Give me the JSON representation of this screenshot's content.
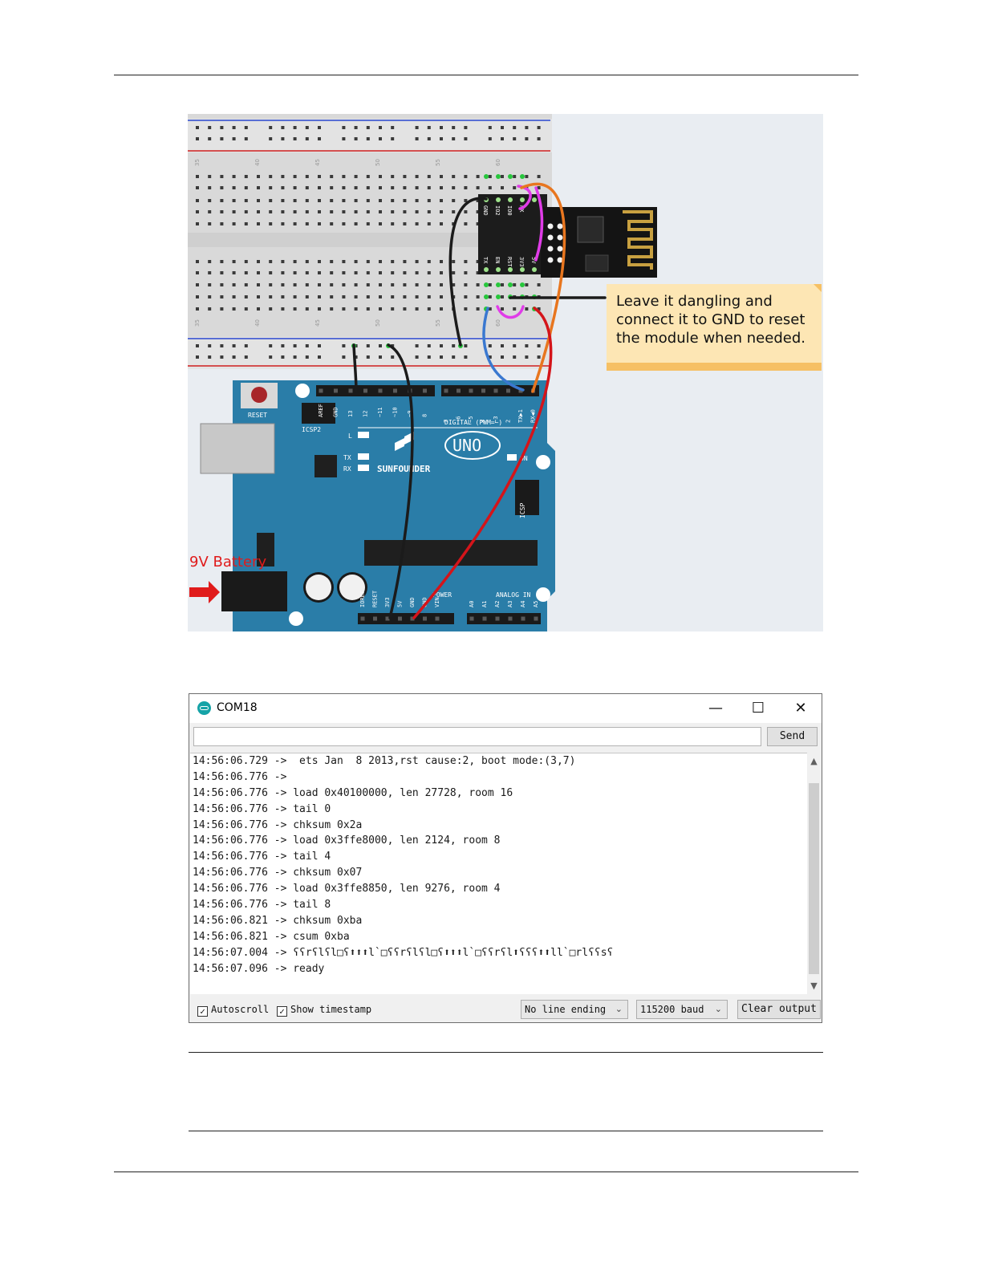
{
  "figure": {
    "note_lines": [
      "Leave it dangling and",
      "connect it to GND to reset",
      "the module when needed."
    ],
    "battery_label": "9V Battery",
    "breadboard_column_numbers": [
      "35",
      "40",
      "45",
      "50",
      "55",
      "60"
    ],
    "esp_pins_top": [
      "GND",
      "IO2",
      "IO0",
      "RX"
    ],
    "esp_pins_bottom": [
      "TX",
      "EN",
      "RST",
      "3V3"
    ],
    "esp_pin_5v": "5V",
    "board": {
      "brand": "SUNFOUNDER",
      "model": "UNO",
      "reset_label": "RESET",
      "icsp2_label": "ICSP2",
      "icsp_label": "ICSP",
      "digital_label": "DIGITAL (PWM=~)",
      "power_label": "POWER",
      "analog_label": "ANALOG IN",
      "led_labels": [
        "L",
        "TX",
        "RX"
      ],
      "on_label": "ON",
      "header_top_left": [
        "AREF",
        "GND",
        "13",
        "12",
        "~11",
        "~10",
        "~9",
        "8"
      ],
      "header_top_right": [
        "7",
        "~6",
        "~5",
        "4",
        "~3",
        "2",
        "TX▶1",
        "RX◀0"
      ],
      "header_power": [
        "IOREF",
        "RESET",
        "3V3",
        "5V",
        "GND",
        "GND",
        "VIN"
      ],
      "header_analog": [
        "A0",
        "A1",
        "A2",
        "A3",
        "A4",
        "A5"
      ]
    },
    "wire_colors": {
      "black": "#1b1b1b",
      "magenta": "#e03ce8",
      "orange": "#e8761f",
      "blue": "#3a78d0",
      "red": "#d4141a",
      "board_blue": "#2a7da8"
    }
  },
  "serial_monitor": {
    "title": "COM18",
    "controls": {
      "minimize": "—",
      "maximize": "☐",
      "close": "✕"
    },
    "input_value": "",
    "send_label": "Send",
    "lines": [
      "14:56:06.729 ->  ets Jan  8 2013,rst cause:2, boot mode:(3,7)",
      "14:56:06.776 -> ",
      "14:56:06.776 -> load 0x40100000, len 27728, room 16",
      "14:56:06.776 -> tail 0",
      "14:56:06.776 -> chksum 0x2a",
      "14:56:06.776 -> load 0x3ffe8000, len 2124, room 8",
      "14:56:06.776 -> tail 4",
      "14:56:06.776 -> chksum 0x07",
      "14:56:06.776 -> load 0x3ffe8850, len 9276, room 4",
      "14:56:06.776 -> tail 8",
      "14:56:06.821 -> chksum 0xba",
      "14:56:06.821 -> csum 0xba",
      "14:56:07.004 -> ʕʕrʕlʕl□ʕ⬆⬆⬆l`□ʕʕrʕlʕl□ʕ⬆⬆⬆l`□ʕʕrʕl⬆ʕʕʕ⬆⬆ll`□rlʕʕsʕ",
      "14:56:07.096 -> ready"
    ],
    "autoscroll_label": "Autoscroll",
    "autoscroll_checked": true,
    "timestamp_label": "Show timestamp",
    "timestamp_checked": true,
    "line_ending": "No line ending",
    "baud": "115200 baud",
    "clear_label": "Clear output"
  }
}
